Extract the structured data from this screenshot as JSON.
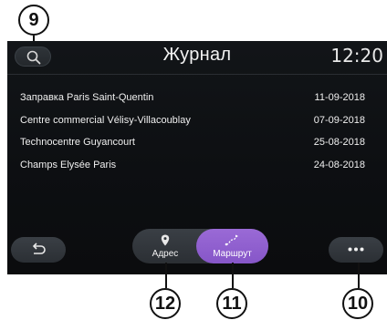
{
  "header": {
    "title": "Журнал",
    "time": "12:20"
  },
  "history": [
    {
      "name": "Заправка Paris Saint-Quentin",
      "date": "11-09-2018"
    },
    {
      "name": "Centre commercial Vélisy-Villacoublay",
      "date": "07-09-2018"
    },
    {
      "name": "Technocentre Guyancourt",
      "date": "25-08-2018"
    },
    {
      "name": "Champs Elysée Paris",
      "date": "24-08-2018"
    }
  ],
  "toolbar": {
    "address_label": "Адрес",
    "route_label": "Маршрут",
    "active_tab": "route"
  },
  "icons": {
    "search": "search-icon",
    "back": "back-arrow-icon",
    "address": "map-pin-icon",
    "route": "route-icon",
    "more": "more-dots-icon"
  },
  "callouts": {
    "search": "9",
    "more": "10",
    "route": "11",
    "address": "12"
  },
  "colors": {
    "screen_bg": "#0d0f12",
    "button_bg": "#2f3439",
    "active_tab": "#8e5fcf",
    "text": "#f0f0f0"
  }
}
